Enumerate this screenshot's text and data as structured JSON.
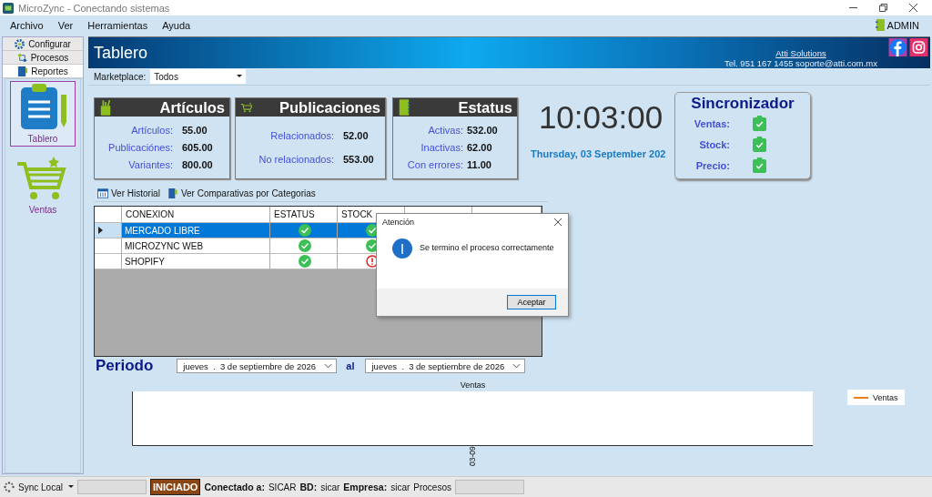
{
  "window": {
    "title": "MicroZync - Conectando sistemas"
  },
  "menu": [
    "Archivo",
    "Ver",
    "Herramientas",
    "Ayuda"
  ],
  "user": "ADMIN",
  "sidebar": {
    "tabs": [
      {
        "label": "Configurar",
        "kind": "gear",
        "selected": false
      },
      {
        "label": "Procesos",
        "kind": "flow",
        "selected": false
      },
      {
        "label": "Reportes",
        "kind": "book",
        "selected": true
      }
    ],
    "items": [
      {
        "label": "Tablero",
        "kind": "clipboard",
        "selected": true
      },
      {
        "label": "Ventas",
        "kind": "cart",
        "selected": false
      }
    ]
  },
  "header": {
    "title": "Tablero",
    "company": "Atti Solutions",
    "contact": "Tel. 951 167 1455  soporte@atti.com.mx"
  },
  "marketplace": {
    "label": "Marketplace:",
    "value": "Todos"
  },
  "cards": [
    {
      "title": "Artículos",
      "kind": "cup",
      "rows": [
        {
          "label": "Artículos:",
          "value": "55.00"
        },
        {
          "label": "Publicaciónes:",
          "value": "605.00"
        },
        {
          "label": "Variantes:",
          "value": "800.00"
        }
      ]
    },
    {
      "title": "Publicaciones",
      "kind": "cart",
      "rows": [
        {
          "label": "Relacionados:",
          "value": "52.00"
        },
        {
          "label": "No relacionados:",
          "value": "553.00"
        }
      ]
    },
    {
      "title": "Estatus",
      "kind": "book",
      "rows": [
        {
          "label": "Activas:",
          "value": "532.00"
        },
        {
          "label": "Inactivas:",
          "value": "62.00"
        },
        {
          "label": "Con errores:",
          "value": "11.00"
        }
      ]
    }
  ],
  "clock": {
    "time": "10:03:00",
    "date": "Thursday, 03 September 202"
  },
  "sync": {
    "title": "Sincronizador",
    "rows": [
      {
        "label": "Ventas:",
        "ok": true
      },
      {
        "label": "Stock:",
        "ok": true
      },
      {
        "label": "Precio:",
        "ok": true
      }
    ]
  },
  "actions": [
    {
      "label": "Ver Historial",
      "kind": "grid"
    },
    {
      "label": "Ver Comparativas por Categorias",
      "kind": "book"
    }
  ],
  "table": {
    "columns": [
      "CONEXION",
      "ESTATUS",
      "STOCK"
    ],
    "rows": [
      {
        "conexion": "MERCADO LIBRE",
        "selected": true,
        "estatus_ok": true,
        "stock_ok": true
      },
      {
        "conexion": "MICROZYNC WEB",
        "selected": false,
        "estatus_ok": true,
        "stock_ok": true
      },
      {
        "conexion": "SHOPIFY",
        "selected": false,
        "estatus_ok": true,
        "stock_ok": false
      }
    ]
  },
  "periodo": {
    "label": "Periodo",
    "from": {
      "day": "jueves",
      "dot": ".",
      "date": "3 de septiembre de 2026"
    },
    "sep": "al",
    "to": {
      "day": "jueves",
      "dot": ".",
      "date": "3 de septiembre de 2026"
    }
  },
  "chart": {
    "title": "Ventas",
    "x_label": "03-09",
    "legend": "Ventas"
  },
  "dialog": {
    "title": "Atención",
    "message": "Se termino el proceso correctamente",
    "button": "Aceptar"
  },
  "status_bar": {
    "sync": "Sync Local",
    "state": "INICIADO",
    "items": [
      {
        "label": "Conectado a:",
        "value": "SICAR"
      },
      {
        "label": "BD:",
        "value": "sicar"
      },
      {
        "label": "Empresa:",
        "value": "sicar"
      }
    ],
    "procesos": "Procesos"
  }
}
